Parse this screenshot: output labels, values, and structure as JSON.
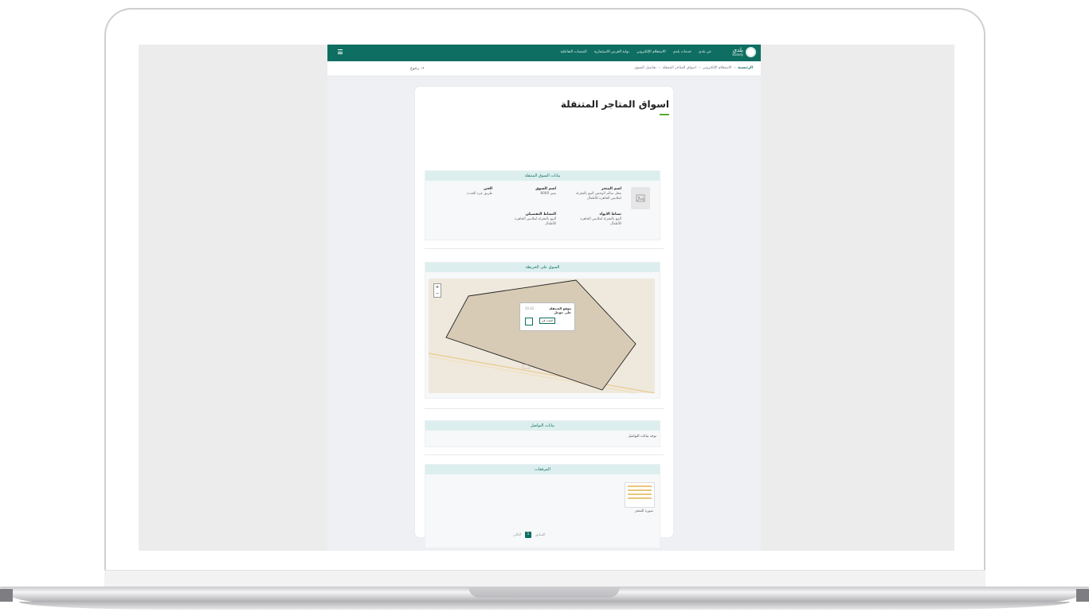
{
  "header": {
    "logo_text": "بلدي",
    "logo_sub": "Balady",
    "nav": [
      "عن بلدي",
      "خدمات بلدي",
      "الاستعلام الإلكتروني",
      "بوابة الفرص الاستثمارية",
      "المنصات التفاعلية"
    ],
    "menu_icon": "menu-icon"
  },
  "breadcrumb": {
    "home": "الرئيسية",
    "items": [
      "الاستعلام الإلكتروني",
      "اسواق المتاجر المتنقلة",
      "تفاصيل السوق"
    ],
    "back_label": "رجوع"
  },
  "page": {
    "title": "اسواق المتاجر المتنقلة"
  },
  "market_section": {
    "header": "بيانات السوق المتنقلة",
    "store_name_label": "اسم المتجر",
    "store_name_value": "محل سالم الوحش البيع بالتجزئة لملابس الجاهزة للأطفال",
    "market_name_label": "اسم السوق",
    "market_name_value": "يمبر 8000",
    "district_label": "الحي",
    "district_value": "طريق عزة الحدث",
    "activity_label": "نشاط الايواء",
    "activity_value": "البيع بالتجزئة لملابس الجاهزة للأطفال",
    "detailed_activity_label": "النشاط التفصيلي",
    "detailed_activity_value": "البيع بالتجزئة لملابس الجاهزة للأطفال"
  },
  "map_section": {
    "header": "السوق على الخريطة",
    "zoom_in": "+",
    "zoom_out": "−",
    "popup_title": "موقع المتنقلة على جوجل",
    "popup_button": "البحث في",
    "popup_coords": "20.62"
  },
  "contact_section": {
    "header": "بيانات التواصل",
    "text": "توجد بيانات التواصل"
  },
  "attachments_section": {
    "header": "المرفقات",
    "attachment_label": "صورة المتجر",
    "pager": {
      "prev": "السابق",
      "current": "1",
      "next": "التالي"
    }
  }
}
